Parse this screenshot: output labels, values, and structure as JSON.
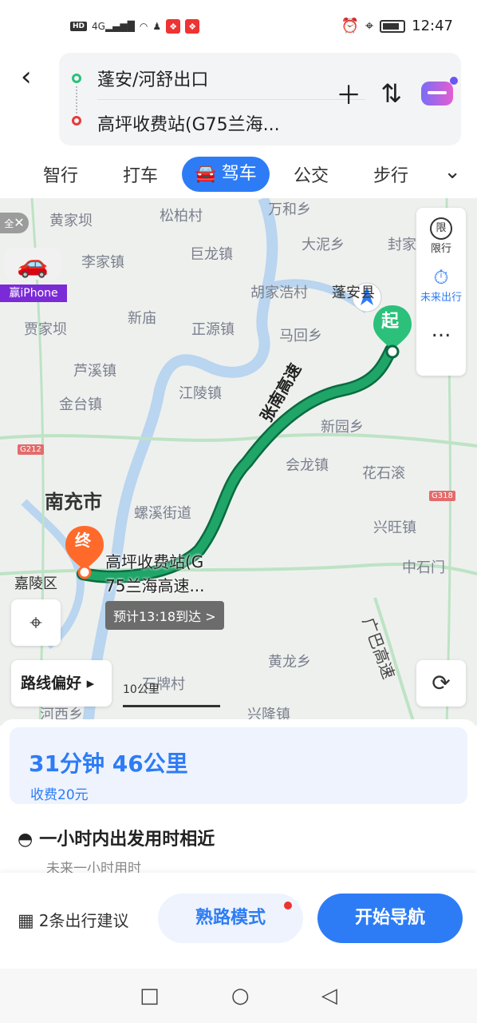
{
  "status_bar": {
    "left_icons": [
      "HD",
      "4G",
      "signal",
      "wifi",
      "qq",
      "app1",
      "app2"
    ],
    "time": "12:47"
  },
  "header": {
    "from": "蓬安/河舒出口",
    "to": "高坪收费站(G75兰海...",
    "back_icon": "chevron-left-icon",
    "add_icon": "plus-icon",
    "swap_icon": "swap-icon",
    "assistant_icon": "ai-assistant-icon"
  },
  "tabs": [
    {
      "label": "智行"
    },
    {
      "label": "打车"
    },
    {
      "label": "驾车",
      "active": true
    },
    {
      "label": "公交"
    },
    {
      "label": "步行"
    }
  ],
  "map": {
    "close_label": "全",
    "promo_label": "赢iPhone",
    "side": {
      "restrict_label": "限行",
      "restrict_icon_text": "限",
      "future_label": "未来出行",
      "more_label": "..."
    },
    "places": {
      "huangjiaba": "黄家坝",
      "songbaicun": "松柏村",
      "wanhexiang": "万和乡",
      "lijiazhen": "李家镇",
      "julongzhen": "巨龙镇",
      "daniaxiang": "大泥乡",
      "fengxiang": "封家",
      "hujiahaocun": "胡家浩村",
      "penganxian": "蓬安县",
      "xinmiao": "新庙",
      "zhengyuanzhen": "正源镇",
      "mahuixiang": "马回乡",
      "jiajiaba": "贾家坝",
      "luxizhen": "芦溪镇",
      "jianglingzhen": "江陵镇",
      "jintaizhen": "金台镇",
      "xinyuanxiang": "新园乡",
      "huilongzhen": "会龙镇",
      "huashigun": "花石滚",
      "nanchongshi": "南充市",
      "luoxijiedao": "螺溪街道",
      "xingwangzhen": "兴旺镇",
      "zhongshimen": "中石门",
      "jialingqu": "嘉陵区",
      "huanglongxiang": "黄龙乡",
      "shipaicun": "石牌村",
      "xinglongzhen": "兴隆镇",
      "hesixiang": "河西乡"
    },
    "shields": {
      "g212": "G212",
      "g318": "G318"
    },
    "road_name_1": "张南高速",
    "road_name_2": "广巴高速",
    "start_pin": "起",
    "end_pin": "终",
    "destination": [
      "高坪收费站(G",
      "75兰海高速..."
    ],
    "eta": "预计13:18到达 >",
    "route_pref": "路线偏好 ▸",
    "scale": "10公里"
  },
  "summary": {
    "main": "31分钟  46公里",
    "toll": "收费20元",
    "tip_title": "一小时内出发用时相近",
    "tip_sub": "未来一小时用时"
  },
  "bottom": {
    "suggest": "2条出行建议",
    "familiar": "熟路模式",
    "start": "开始导航"
  },
  "colors": {
    "accent": "#2d7cf6",
    "route": "#1fa568",
    "start": "#2bc17a",
    "end": "#ff6a2b"
  }
}
